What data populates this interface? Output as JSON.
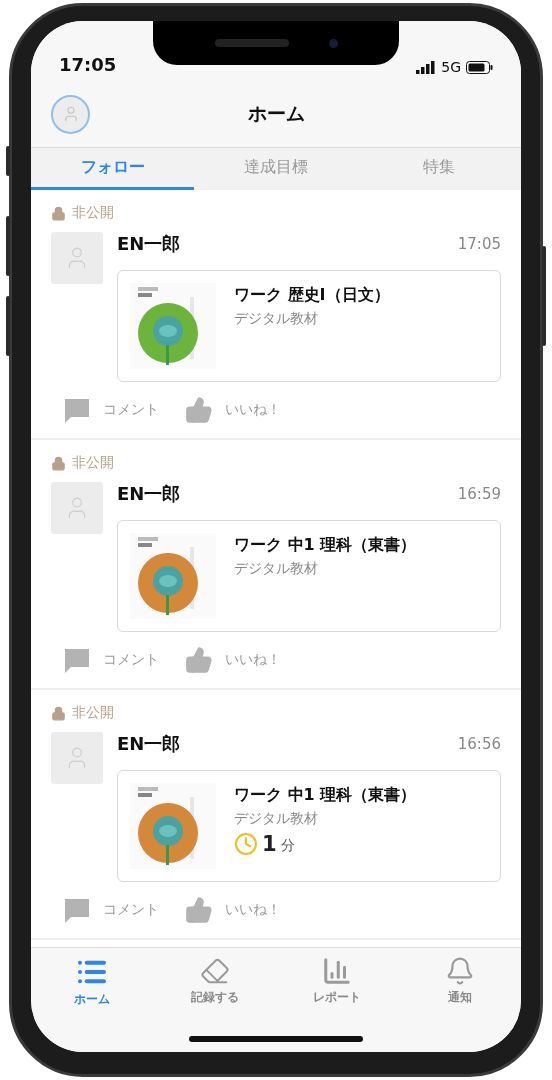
{
  "status_bar": {
    "time": "17:05",
    "network": "5G"
  },
  "header": {
    "title": "ホーム"
  },
  "tabs": [
    {
      "label": "フォロー",
      "selected": true
    },
    {
      "label": "達成目標",
      "selected": false
    },
    {
      "label": "特集",
      "selected": false
    }
  ],
  "posts": [
    {
      "visibility": "非公開",
      "user": "EN一郎",
      "time": "17:05",
      "title": "ワーク 歴史I（日文）",
      "subtitle": "デジタル教材",
      "cover": {
        "kind": "picture",
        "color": "#6cb43c"
      },
      "actions": [
        "コメント",
        "いいね！"
      ]
    },
    {
      "visibility": "非公開",
      "user": "EN一郎",
      "time": "16:59",
      "title": "ワーク 中1 理科（東書）",
      "subtitle": "デジタル教材",
      "cover": {
        "kind": "picture",
        "color": "#d4883a"
      },
      "actions": [
        "コメント",
        "いいね！"
      ]
    },
    {
      "visibility": "非公開",
      "user": "EN一郎",
      "time": "16:56",
      "title": "ワーク 中1 理科（東書）",
      "subtitle": "デジタル教材",
      "cover": {
        "kind": "picture",
        "color": "#d4883a"
      },
      "duration": {
        "value": "1",
        "unit": "分"
      },
      "actions": [
        "コメント",
        "いいね！"
      ]
    }
  ],
  "tab_bar": [
    {
      "kind": "list",
      "label": "ホーム",
      "selected": true
    },
    {
      "kind": "eraser",
      "label": "記録する",
      "selected": false
    },
    {
      "kind": "chart",
      "label": "レポート",
      "selected": false
    },
    {
      "kind": "bell",
      "label": "通知",
      "selected": false
    }
  ]
}
